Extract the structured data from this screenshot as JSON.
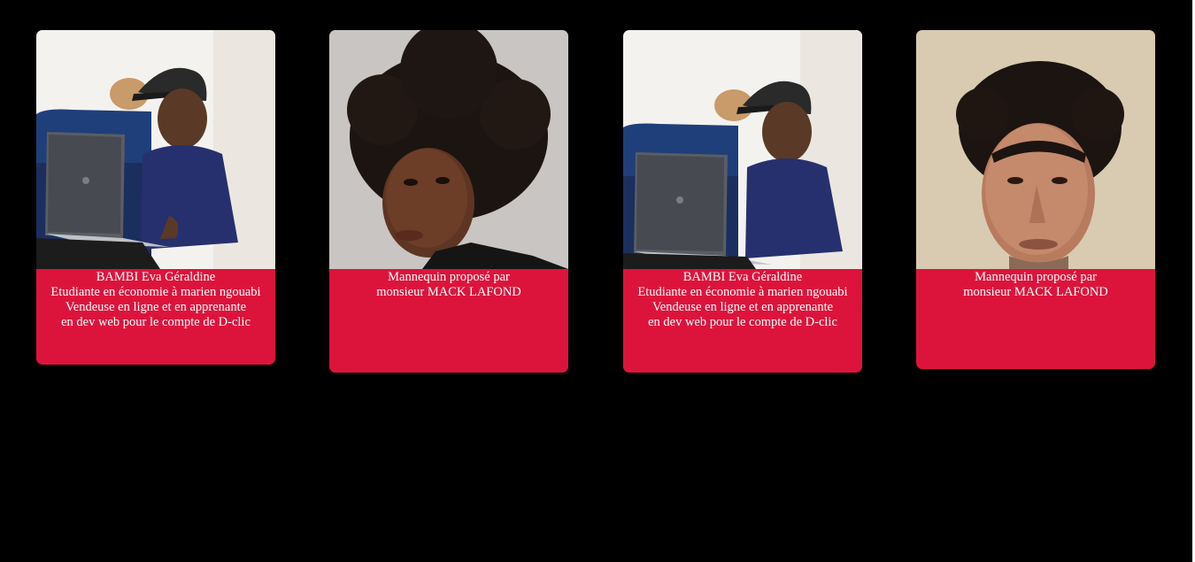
{
  "cards": [
    {
      "photo_icon": "person-with-laptop-icon",
      "caption": [
        "BAMBI Eva Géraldine",
        "Etudiante en économie à marien ngouabi",
        "Vendeuse en ligne et en apprenante",
        "en dev web pour le compte de D-clic"
      ]
    },
    {
      "photo_icon": "portrait-woman-icon",
      "caption": [
        "Mannequin proposé par",
        "monsieur MACK LAFOND"
      ]
    },
    {
      "photo_icon": "person-with-laptop-icon",
      "caption": [
        "BAMBI Eva Géraldine",
        "Etudiante en économie à marien ngouabi",
        "Vendeuse en ligne et en apprenante",
        "en dev web pour le compte de D-clic"
      ]
    },
    {
      "photo_icon": "portrait-man-icon",
      "caption": [
        "Mannequin proposé par",
        "monsieur MACK LAFOND"
      ]
    }
  ],
  "colors": {
    "background": "#000000",
    "card_accent": "#dc143c",
    "caption_text": "#ffffff"
  }
}
